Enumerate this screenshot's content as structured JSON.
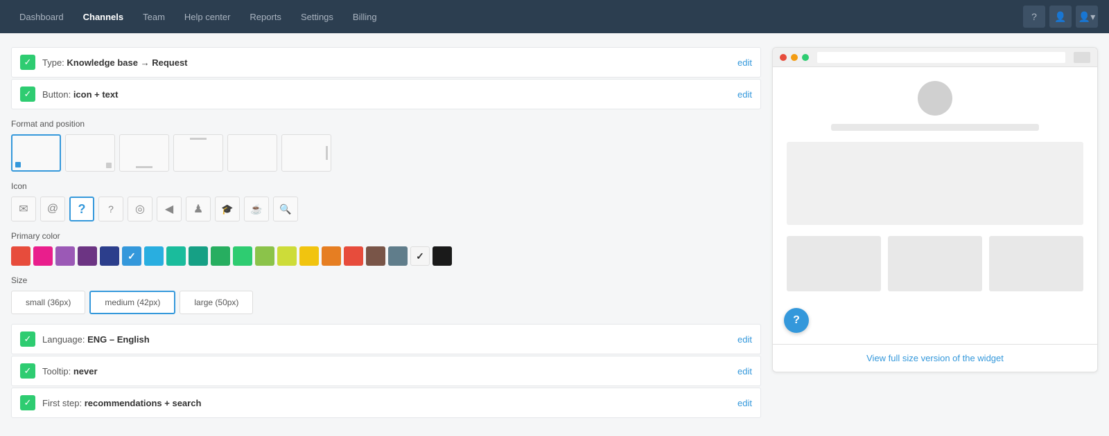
{
  "nav": {
    "items": [
      {
        "label": "Dashboard",
        "active": false
      },
      {
        "label": "Channels",
        "active": true
      },
      {
        "label": "Team",
        "active": false
      },
      {
        "label": "Help center",
        "active": false
      },
      {
        "label": "Reports",
        "active": false
      },
      {
        "label": "Settings",
        "active": false
      },
      {
        "label": "Billing",
        "active": false
      }
    ]
  },
  "rows": [
    {
      "label": "Type: ",
      "value": "Knowledge base → Request",
      "edit": "edit"
    },
    {
      "label": "Button: ",
      "value": "icon + text",
      "edit": "edit"
    }
  ],
  "sections": {
    "format": {
      "label": "Format and position",
      "options": [
        {
          "id": "bottom-left",
          "selected": true
        },
        {
          "id": "bottom-right",
          "selected": false
        },
        {
          "id": "bottom-center",
          "selected": false
        },
        {
          "id": "top-left",
          "selected": false
        },
        {
          "id": "top-right",
          "selected": false
        },
        {
          "id": "side",
          "selected": false
        }
      ]
    },
    "icon": {
      "label": "Icon",
      "options": [
        {
          "id": "mail",
          "symbol": "✉",
          "selected": false
        },
        {
          "id": "at",
          "symbol": "@",
          "selected": false
        },
        {
          "id": "question-circle",
          "symbol": "?",
          "selected": true
        },
        {
          "id": "question",
          "symbol": "?",
          "selected": false
        },
        {
          "id": "life-ring",
          "symbol": "◎",
          "selected": false
        },
        {
          "id": "comment",
          "symbol": "◂",
          "selected": false
        },
        {
          "id": "user",
          "symbol": "♟",
          "selected": false
        },
        {
          "id": "graduation",
          "symbol": "🎓",
          "selected": false
        },
        {
          "id": "coffee",
          "symbol": "☕",
          "selected": false
        },
        {
          "id": "search",
          "symbol": "🔍",
          "selected": false
        }
      ]
    },
    "primaryColor": {
      "label": "Primary color",
      "colors": [
        {
          "hex": "#e74c3c",
          "selected": false
        },
        {
          "hex": "#e91e8c",
          "selected": false
        },
        {
          "hex": "#9b59b6",
          "selected": false
        },
        {
          "hex": "#6c3483",
          "selected": false
        },
        {
          "hex": "#2c3e8c",
          "selected": false
        },
        {
          "hex": "#3498db",
          "selected": true
        },
        {
          "hex": "#2980b9",
          "selected": false
        },
        {
          "hex": "#1abc9c",
          "selected": false
        },
        {
          "hex": "#16a085",
          "selected": false
        },
        {
          "hex": "#27ae60",
          "selected": false
        },
        {
          "hex": "#2ecc71",
          "selected": false
        },
        {
          "hex": "#8bc34a",
          "selected": false
        },
        {
          "hex": "#cddc39",
          "selected": false
        },
        {
          "hex": "#f1c40f",
          "selected": false
        },
        {
          "hex": "#e67e22",
          "selected": false
        },
        {
          "hex": "#e74c3c",
          "selected": false
        },
        {
          "hex": "#795548",
          "selected": false
        },
        {
          "hex": "#607d8b",
          "selected": false
        },
        {
          "hex": "#f5f5f5",
          "selected": false,
          "dark": true
        },
        {
          "hex": "#1a1a1a",
          "selected": false
        }
      ]
    },
    "size": {
      "label": "Size",
      "options": [
        {
          "label": "small (36px)",
          "selected": false
        },
        {
          "label": "medium (42px)",
          "selected": true
        },
        {
          "label": "large (50px)",
          "selected": false
        }
      ]
    }
  },
  "bottomRows": [
    {
      "label": "Language: ",
      "value": "ENG – English",
      "edit": "edit"
    },
    {
      "label": "Tooltip: ",
      "value": "never",
      "edit": "edit"
    },
    {
      "label": "First step: ",
      "value": "recommendations + search",
      "edit": "edit"
    }
  ],
  "preview": {
    "trafficLights": [
      "#e74c3c",
      "#f39c12",
      "#2ecc71"
    ],
    "viewFullLink": "View full size version of the widget"
  }
}
